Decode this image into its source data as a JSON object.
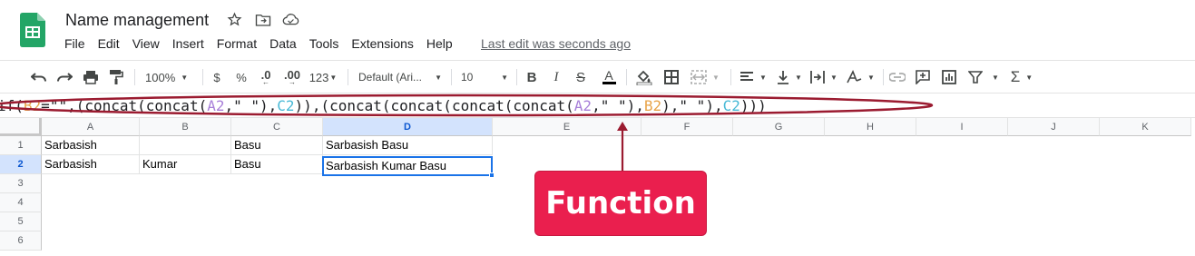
{
  "app": {
    "doc_title": "Name management",
    "last_edit": "Last edit was seconds ago",
    "title_icons": [
      "star-icon",
      "move-to-folder-icon",
      "cloud-status-icon"
    ]
  },
  "menu": [
    "File",
    "Edit",
    "View",
    "Insert",
    "Format",
    "Data",
    "Tools",
    "Extensions",
    "Help"
  ],
  "toolbar": {
    "zoom": "100%",
    "currency": "$",
    "percent": "%",
    "decrease_decimals": ".0",
    "increase_decimals": ".00",
    "more_formats": "123",
    "font": "Default (Ari...",
    "font_size": "10"
  },
  "formula_bar": {
    "parts": [
      {
        "text": "if(",
        "kind": "plain"
      },
      {
        "text": "B2",
        "kind": "ref1"
      },
      {
        "text": "=",
        "kind": "plain"
      },
      {
        "text": "\"\"",
        "kind": "str"
      },
      {
        "text": ",(concat(concat(",
        "kind": "plain"
      },
      {
        "text": "A2",
        "kind": "ref2"
      },
      {
        "text": ",",
        "kind": "plain"
      },
      {
        "text": "\" \"",
        "kind": "str"
      },
      {
        "text": "),",
        "kind": "plain"
      },
      {
        "text": "C2",
        "kind": "ref3"
      },
      {
        "text": ")),(concat(concat(concat(concat(",
        "kind": "plain"
      },
      {
        "text": "A2",
        "kind": "ref2"
      },
      {
        "text": ",",
        "kind": "plain"
      },
      {
        "text": "\" \"",
        "kind": "str"
      },
      {
        "text": "),",
        "kind": "plain"
      },
      {
        "text": "B2",
        "kind": "ref1"
      },
      {
        "text": "),",
        "kind": "plain"
      },
      {
        "text": "\" \"",
        "kind": "str"
      },
      {
        "text": "),",
        "kind": "plain"
      },
      {
        "text": "C2",
        "kind": "ref3"
      },
      {
        "text": ")))",
        "kind": "plain"
      }
    ],
    "ref_colors": {
      "ref1": "#e8a34a",
      "ref2": "#a87fd9",
      "ref3": "#47b9d6"
    }
  },
  "sheet": {
    "columns": [
      "A",
      "B",
      "C",
      "D",
      "E",
      "F",
      "G",
      "H",
      "I",
      "J",
      "K"
    ],
    "rows": [
      "1",
      "2",
      "3",
      "4",
      "5",
      "6"
    ],
    "selected_column": "D",
    "selected_row": "2",
    "active_cell": "D2",
    "cells": {
      "A1": "Sarbasish",
      "B1": "",
      "C1": "Basu",
      "D1": "Sarbasish Basu",
      "A2": "Sarbasish",
      "B2": "Kumar",
      "C2": "Basu",
      "D2": "Sarbasish Kumar Basu"
    }
  },
  "annotation": {
    "label": "Function",
    "color": "#ea1f4e",
    "outline_color": "#9b1b30"
  }
}
